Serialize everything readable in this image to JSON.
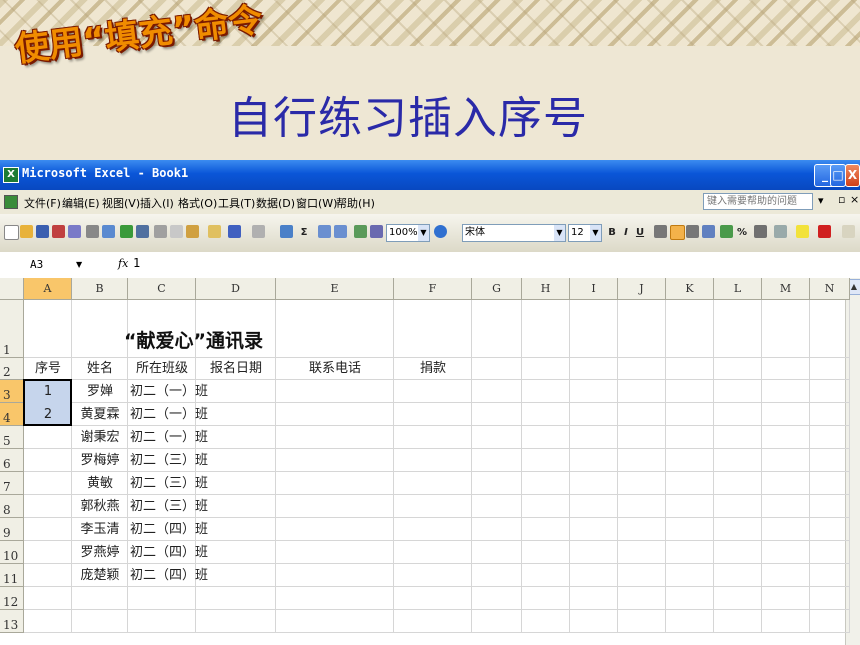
{
  "slide": {
    "wordart": "使用“填充”命令",
    "title": "自行练习插入序号"
  },
  "window": {
    "title": "Microsoft Excel - Book1",
    "min": "_",
    "max": "□",
    "close": "X"
  },
  "menu": {
    "items": [
      "文件(F)",
      "编辑(E)",
      "视图(V)",
      "插入(I)",
      "格式(O)",
      "工具(T)",
      "数据(D)",
      "窗口(W)",
      "帮助(H)"
    ],
    "help_placeholder": "键入需要帮助的问题"
  },
  "toolbar": {
    "zoom": "100%",
    "font": "宋体",
    "size": "12",
    "bold": "B",
    "italic": "I",
    "underline": "U",
    "sigma": "Σ",
    "percent": "%"
  },
  "formula_bar": {
    "name_box": "A3",
    "fx": "fx",
    "value": "1"
  },
  "columns": [
    "A",
    "B",
    "C",
    "D",
    "E",
    "F",
    "G",
    "H",
    "I",
    "J",
    "K",
    "L",
    "M",
    "N"
  ],
  "rows": [
    "1",
    "2",
    "3",
    "4",
    "5",
    "6",
    "7",
    "8",
    "9",
    "10",
    "11",
    "12",
    "13"
  ],
  "sheet": {
    "title": "“献爱心”通讯录",
    "headers": [
      "序号",
      "姓名",
      "所在班级",
      "报名日期",
      "联系电话",
      "捐款"
    ],
    "records": [
      {
        "no": "1",
        "name": "罗婵",
        "class": "初二（一）班"
      },
      {
        "no": "2",
        "name": "黄夏霖",
        "class": "初二（一）班"
      },
      {
        "no": "",
        "name": "谢秉宏",
        "class": "初二（一）班"
      },
      {
        "no": "",
        "name": "罗梅婷",
        "class": "初二（三）班"
      },
      {
        "no": "",
        "name": "黄敏",
        "class": "初二（三）班"
      },
      {
        "no": "",
        "name": "郭秋燕",
        "class": "初二（三）班"
      },
      {
        "no": "",
        "name": "李玉清",
        "class": "初二（四）班"
      },
      {
        "no": "",
        "name": "罗燕婷",
        "class": "初二（四）班"
      },
      {
        "no": "",
        "name": "庞楚颖",
        "class": "初二（四）班"
      }
    ]
  },
  "colors": {
    "title_blue": "#2a2aa8",
    "wordart_orange": "#f08c00",
    "selection": "#c6d5ec",
    "header_selected": "#f9c66a"
  }
}
